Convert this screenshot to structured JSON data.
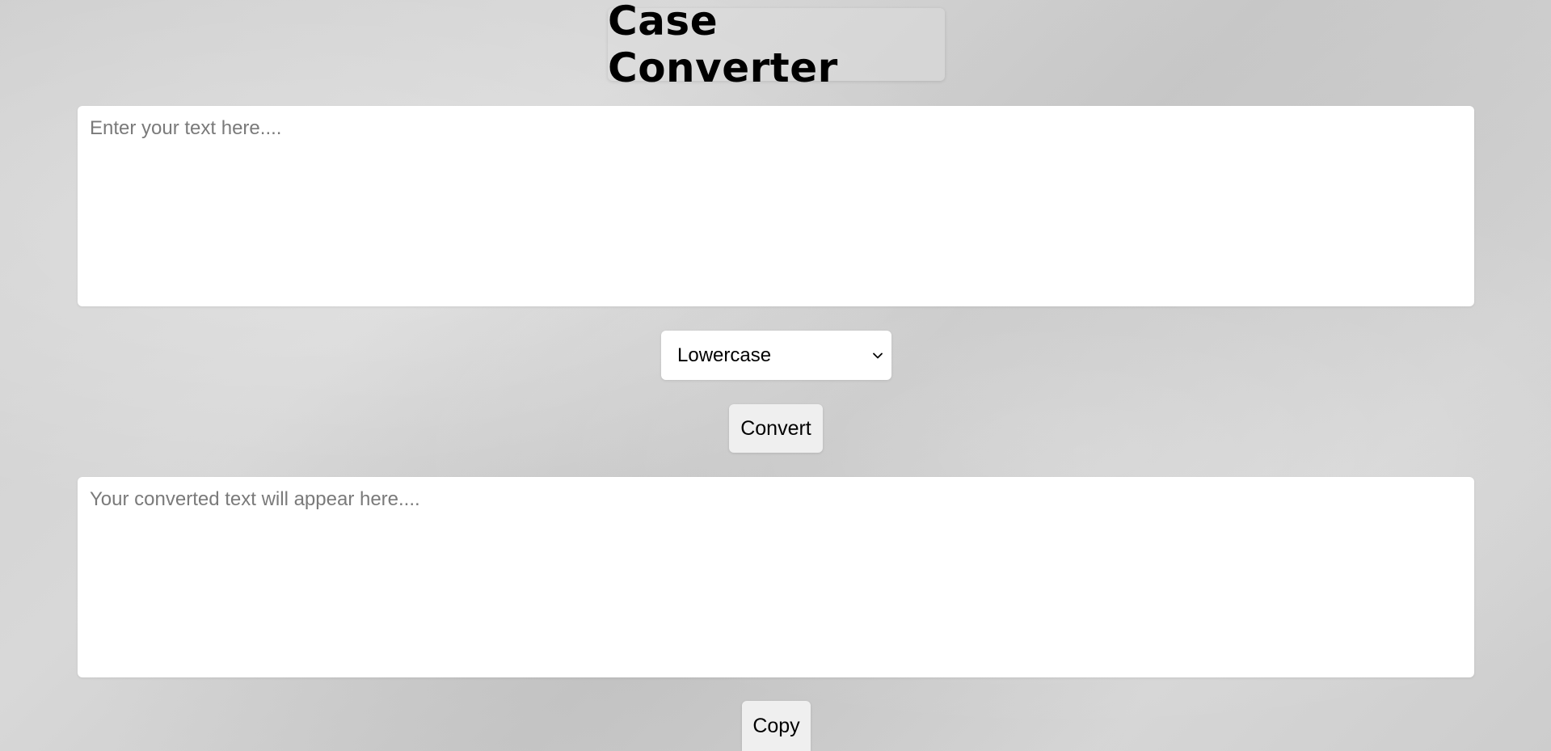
{
  "header": {
    "title": "Case Converter"
  },
  "input": {
    "placeholder": "Enter your text here....",
    "value": ""
  },
  "case_select": {
    "selected": "Lowercase",
    "icon": "chevron-down-icon"
  },
  "buttons": {
    "convert_label": "Convert",
    "copy_label": "Copy"
  },
  "output": {
    "placeholder": "Your converted text will appear here....",
    "value": ""
  },
  "colors": {
    "background": "#d3d3d3",
    "panel": "#ffffff",
    "button": "#efefef",
    "text": "#000000",
    "placeholder": "#7a7a7a"
  }
}
